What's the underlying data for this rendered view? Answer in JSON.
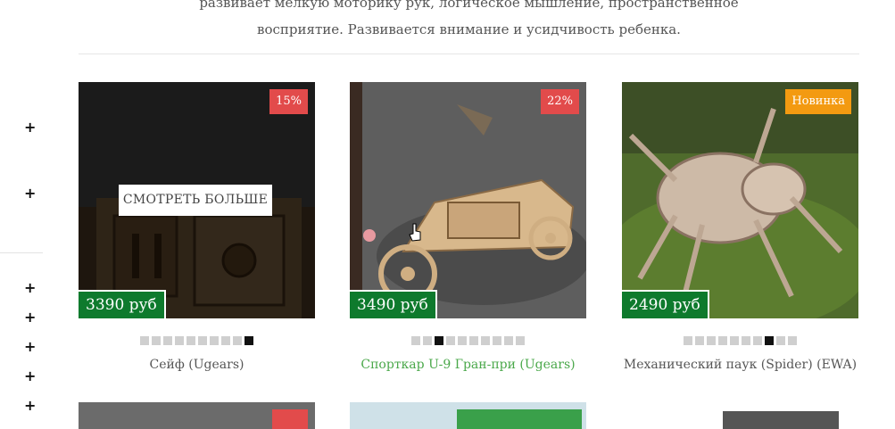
{
  "intro": {
    "line1": "развивает мелкую моторику рук, логическое мышление, пространственное",
    "line2": "восприятие. Развивается внимание и усидчивость ребенка."
  },
  "sidebar": {
    "items": [
      "+",
      "+",
      "+",
      "+",
      "+",
      "+",
      "+"
    ]
  },
  "products": [
    {
      "badge": "15%",
      "price": "3390 руб",
      "name": "Сейф (Ugears)",
      "hover_button": "СМОТРЕТЬ БОЛЬШЕ",
      "slides": 10,
      "active_slide": 10
    },
    {
      "badge": "22%",
      "price": "3490 руб",
      "name": "Спорткар U-9 Гран-при (Ugears)",
      "slides": 10,
      "active_slide": 3
    },
    {
      "badge": "Новинка",
      "price": "2490 руб",
      "name": "Механический паук (Spider) (EWA)",
      "slides": 10,
      "active_slide": 8
    }
  ],
  "colors": {
    "price_bg": "#0e7a2d",
    "badge_discount": "#e24b4b",
    "badge_new": "#f39a11",
    "link_green": "#4aa84a"
  }
}
